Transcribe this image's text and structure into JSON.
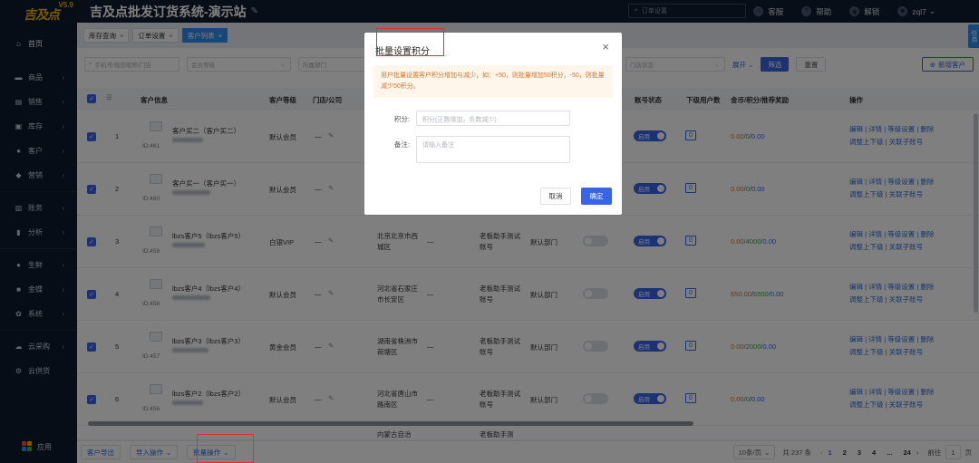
{
  "app": {
    "logo": "吉及点",
    "version": "V5.9",
    "title": "吉及点批发订货系统-演示站",
    "search_placeholder": "订单设置",
    "top_links": [
      {
        "label": "客服",
        "icon": "customer-service-icon"
      },
      {
        "label": "帮助",
        "icon": "help-icon"
      },
      {
        "label": "解锁",
        "icon": "unlock-icon"
      },
      {
        "label": "zql7",
        "icon": "user-icon"
      }
    ],
    "side_tag": "任务"
  },
  "sidebar": {
    "home": "首页",
    "items": [
      {
        "label": "商品",
        "icon": "cart-icon"
      },
      {
        "label": "销售",
        "icon": "sales-icon"
      },
      {
        "label": "库存",
        "icon": "inventory-icon"
      },
      {
        "label": "客户",
        "icon": "customer-icon"
      },
      {
        "label": "营销",
        "icon": "marketing-icon"
      },
      {
        "label": "账务",
        "icon": "account-icon"
      },
      {
        "label": "分析",
        "icon": "chart-icon"
      },
      {
        "label": "生鲜",
        "icon": "fresh-icon"
      },
      {
        "label": "金蝶",
        "icon": "kingdee-icon"
      },
      {
        "label": "系统",
        "icon": "system-icon"
      },
      {
        "label": "云采购",
        "icon": "cloud-purchase-icon"
      },
      {
        "label": "云供货",
        "icon": "cloud-supply-icon"
      }
    ],
    "apps": "应用"
  },
  "tabs": [
    {
      "label": "库存查询",
      "active": false
    },
    {
      "label": "订单设置",
      "active": false
    },
    {
      "label": "客户列表",
      "active": true
    }
  ],
  "filters": {
    "keyword_placeholder": "手机号/微信昵称/门店",
    "level_placeholder": "会员等级",
    "dept_placeholder": "所属部门",
    "store_status": "门店状态",
    "expand": "展开",
    "search": "筛选",
    "reset": "重置",
    "new_customer": "新增客户"
  },
  "table": {
    "headers": {
      "info": "客户信息",
      "level": "客户等级",
      "store": "门店/公司",
      "status": "账号状态",
      "sub_count": "下级用户数",
      "points": "金币/积分/推荐奖励",
      "ops": "操作"
    },
    "rows": [
      {
        "no": "1",
        "name": "客户买二（客户买二）",
        "id": "ID:461",
        "level": "默认会员",
        "store": "—",
        "region": "",
        "salesman": "",
        "dept": "",
        "sub": "0",
        "gold": "0.00",
        "score": "0",
        "reward": "0.00"
      },
      {
        "no": "2",
        "name": "客户买一（客户买一）",
        "id": "ID:460",
        "level": "默认会员",
        "store": "—",
        "region": "",
        "salesman": "",
        "dept": "",
        "sub": "0",
        "gold": "0.00",
        "score": "0",
        "reward": "0.00"
      },
      {
        "no": "3",
        "name": "lbzs客户5（lbzs客户5）",
        "id": "ID:459",
        "level": "白银VIP",
        "store": "—",
        "region": "北京北京市西城区",
        "salesman": "老板助手测试账号",
        "dept": "默认部门",
        "sub": "0",
        "gold": "0.00",
        "score": "4000",
        "reward": "0.00"
      },
      {
        "no": "4",
        "name": "lbzs客户4（lbzs客户4）",
        "id": "ID:458",
        "level": "默认会员",
        "store": "—",
        "region": "河北省石家庄市长安区",
        "salesman": "老板助手测试账号",
        "dept": "默认部门",
        "sub": "0",
        "gold": "650.00",
        "score": "6500",
        "reward": "0.00"
      },
      {
        "no": "5",
        "name": "lbzs客户3（lbzs客户3）",
        "id": "ID:457",
        "level": "黄金会员",
        "store": "—",
        "region": "湖南省株洲市荷塘区",
        "salesman": "老板助手测试账号",
        "dept": "默认部门",
        "sub": "0",
        "gold": "0.00",
        "score": "2000",
        "reward": "0.00"
      },
      {
        "no": "6",
        "name": "lbzs客户2（lbzs客户2）",
        "id": "ID:456",
        "level": "默认会员",
        "store": "—",
        "region": "河北省唐山市路南区",
        "salesman": "老板助手测试账号",
        "dept": "默认部门",
        "sub": "0",
        "gold": "0.00",
        "score": "0",
        "reward": "0.00"
      }
    ],
    "partial_row": {
      "region": "内蒙古自治",
      "salesman": "老板助手测"
    },
    "toggle_on": "启用",
    "ops_line1": "编辑 | 详情 | 等级设置 | 删除",
    "ops_line2": "调整上下级 | 关联子账号",
    "points_sep": "/"
  },
  "footer": {
    "export": "客户导出",
    "import": "导入操作",
    "batch": "批量操作",
    "page_size": "10条/页",
    "total": "共 237 条",
    "pages": [
      "1",
      "2",
      "3",
      "4",
      "...",
      "24"
    ],
    "goto": "前往",
    "goto_page": "1",
    "page_unit": "页"
  },
  "modal": {
    "title": "批量设置积分",
    "tip": "用户批量设置客户积分增加与减少，如：+50，则批量增加50积分，-50，则批量减少50积分。",
    "score_label": "积分:",
    "score_placeholder": "积分(正数增加，负数减少)",
    "remark_label": "备注:",
    "remark_placeholder": "请输入备注",
    "cancel": "取消",
    "ok": "确定"
  }
}
